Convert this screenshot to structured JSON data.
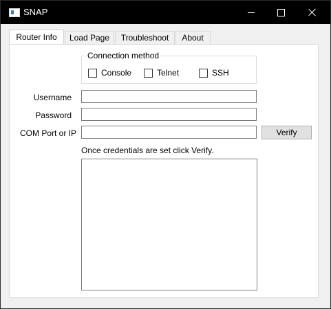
{
  "window": {
    "title": "SNAP",
    "icon": "app-window-icon"
  },
  "title_buttons": {
    "minimize": "minimize-icon",
    "maximize": "maximize-icon",
    "close": "close-icon"
  },
  "tabs": [
    {
      "label": "Router Info",
      "active": true
    },
    {
      "label": "Load Page",
      "active": false
    },
    {
      "label": "Troubleshoot",
      "active": false
    },
    {
      "label": "About",
      "active": false
    }
  ],
  "connection": {
    "title": "Connection method",
    "options": [
      {
        "label": "Console",
        "checked": false
      },
      {
        "label": "Telnet",
        "checked": false
      },
      {
        "label": "SSH",
        "checked": false
      }
    ]
  },
  "form": {
    "username_label": "Username",
    "username_value": "",
    "password_label": "Password",
    "password_value": "",
    "com_label": "COM Port or IP",
    "com_value": "",
    "verify_label": "Verify",
    "hint": "Once credentials are set click Verify.",
    "output_value": ""
  }
}
